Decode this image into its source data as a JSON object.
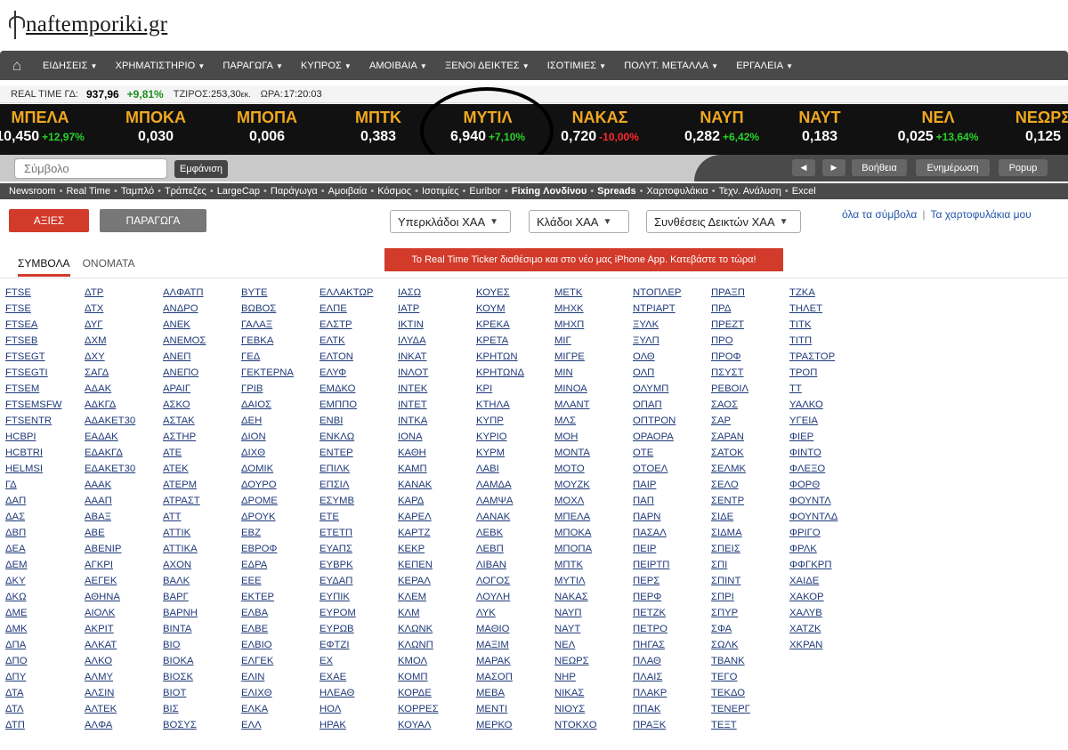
{
  "brand": {
    "name": "naftemporiki",
    "tld": ".gr"
  },
  "topnav": {
    "items": [
      "ΕΙΔΗΣΕΙΣ",
      "ΧΡΗΜΑΤΙΣΤΗΡΙΟ",
      "ΠΑΡΑΓΩΓΑ",
      "ΚΥΠΡΟΣ",
      "ΑΜΟΙΒΑΙΑ",
      "ΞΕΝΟΙ ΔΕΙΚΤΕΣ",
      "ΙΣΟΤΙΜΙΕΣ",
      "ΠΟΛΥΤ. ΜΕΤΑΛΛΑ",
      "ΕΡΓΑΛΕΙΑ"
    ]
  },
  "realtime": {
    "label_gd": "REAL TIME ΓΔ:",
    "gd_value": "937,96",
    "gd_change": "+9,81%",
    "turnover_label": "ΤΖΙΡΟΣ:",
    "turnover_value": "253,30",
    "turnover_unit": "εκ.",
    "time_label": "ΩΡΑ:",
    "time_value": "17:20:03"
  },
  "ticker": [
    {
      "sym": "ΜΠΕΛΑ",
      "price": "10,450",
      "chg": "+12,97%",
      "dir": "up"
    },
    {
      "sym": "ΜΠΟΚΑ",
      "price": "0,030",
      "chg": "",
      "dir": ""
    },
    {
      "sym": "ΜΠΟΠΑ",
      "price": "0,006",
      "chg": "",
      "dir": ""
    },
    {
      "sym": "ΜΠΤΚ",
      "price": "0,383",
      "chg": "",
      "dir": ""
    },
    {
      "sym": "ΜΥΤΙΛ",
      "price": "6,940",
      "chg": "+7,10%",
      "dir": "up"
    },
    {
      "sym": "ΝΑΚΑΣ",
      "price": "0,720",
      "chg": "-10,00%",
      "dir": "dn"
    },
    {
      "sym": "ΝΑΥΠ",
      "price": "0,282",
      "chg": "+6,42%",
      "dir": "up"
    },
    {
      "sym": "ΝΑΥΤ",
      "price": "0,183",
      "chg": "",
      "dir": ""
    },
    {
      "sym": "ΝΕΛ",
      "price": "0,025",
      "chg": "+13,64%",
      "dir": "up"
    },
    {
      "sym": "ΝΕΩΡΣ",
      "price": "0,125",
      "chg": "",
      "dir": ""
    }
  ],
  "search": {
    "placeholder": "Σύμβολο",
    "button": "Εμφάνιση",
    "prev": "◀",
    "next": "▶",
    "help": "Βοήθεια",
    "update": "Ενημέρωση",
    "popup": "Popup"
  },
  "linkbar": {
    "links": [
      "Newsroom",
      "Real Time",
      "Ταμπλό",
      "Τράπεζες",
      "LargeCap",
      "Παράγωγα",
      "Αμοιβαία",
      "Κόσμος",
      "Ισοτιμίες",
      "Euribor",
      "Fixing Λονδίνου",
      "Spreads",
      "Χαρτοφυλάκια",
      "Τεχν. Ανάλυση",
      "Excel"
    ]
  },
  "tabs": {
    "stocks": "ΑΞΙΕΣ",
    "derivatives": "ΠΑΡΑΓΩΓΑ"
  },
  "dropdowns": {
    "supersectors": "Υπερκλάδοι ΧΑΑ",
    "sectors": "Κλάδοι ΧΑΑ",
    "composites": "Συνθέσεις Δεικτών ΧΑΑ"
  },
  "toplinks": {
    "all_symbols": "όλα τα σύμβολα",
    "separator": "|",
    "portfolios": "Τα χαρτοφυλάκια μου"
  },
  "subtabs": {
    "symbols": "ΣΥΜΒΟΛΑ",
    "names": "ΟΝΟΜΑΤΑ"
  },
  "promo": "Το Real Time Ticker διαθέσιμο και στο νέο μας iPhone App. Κατεβάστε το τώρα!",
  "symbols": [
    [
      "FTSE",
      "FTSE",
      "FTSEA",
      "FTSEB",
      "FTSEGT",
      "FTSEGTI",
      "FTSEM",
      "FTSEMSFW",
      "FTSENTR",
      "HCBPI",
      "HCBTRI",
      "HELMSI",
      "ΓΔ",
      "ΔΑΠ",
      "ΔΑΣ",
      "ΔΒΠ",
      "ΔΕΑ",
      "ΔΕΜ",
      "ΔΚΥ",
      "ΔΚΩ",
      "ΔΜΕ",
      "ΔΜΚ",
      "ΔΠΑ",
      "ΔΠΟ",
      "ΔΠΥ",
      "ΔΤΑ",
      "ΔΤΛ",
      "ΔΤΠ"
    ],
    [
      "ΔΤΡ",
      "ΔΤΧ",
      "ΔΥΓ",
      "ΔΧΜ",
      "ΔΧΥ",
      "ΣΑΓΔ",
      "ΑΔΑΚ",
      "ΑΔΚΓΔ",
      "ΑΔΑΚΕΤ30",
      "ΕΑΔΑΚ",
      "ΕΔΑΚΓΔ",
      "ΕΔΑΚΕΤ30",
      "ΑΑΑΚ",
      "ΑΑΑΠ",
      "ΑΒΑΞ",
      "ΑΒΕ",
      "ABENIP",
      "ΑΓΚΡΙ",
      "ΑΕΓΕΚ",
      "ΑΘΗΝΑ",
      "ΑΙΟΛΚ",
      "ΑΚΡΙΤ",
      "ΑΛΚΑΤ",
      "ΑΛΚΟ",
      "ΑΛΜΥ",
      "ΑΛΣΙΝ",
      "ΑΛΤΕΚ",
      "ΑΛΦΑ"
    ],
    [
      "ΑΛΦΑΤΠ",
      "ΑΝΔΡΟ",
      "ΑΝΕΚ",
      "ΑΝΕΜΟΣ",
      "ΑΝΕΠ",
      "ΑΝΕΠΟ",
      "ΑΡΑΙΓ",
      "ΑΣΚΟ",
      "ΑΣΤΑΚ",
      "ΑΣΤΗΡ",
      "ΑΤΕ",
      "ΑΤΕΚ",
      "ΑΤΕΡΜ",
      "ΑΤΡΑΣΤ",
      "ΑΤΤ",
      "ΑΤΤΙΚ",
      "ΑΤΤΙΚΑ",
      "ΑΧΟΝ",
      "ΒΑΛΚ",
      "ΒΑΡΓ",
      "ΒΑΡΝΗ",
      "ΒΙΝΤΑ",
      "ΒΙΟ",
      "ΒΙΟΚΑ",
      "ΒΙΟΣΚ",
      "ΒΙΟΤ",
      "ΒΙΣ",
      "ΒΟΣΥΣ"
    ],
    [
      "ΒΥΤΕ",
      "ΒΩΒΟΣ",
      "ΓΑΛΑΞ",
      "ΓΕΒΚΑ",
      "ΓΕΔ",
      "ΓΕΚΤΕΡΝΑ",
      "ΓΡΙΒ",
      "ΔΑΙΟΣ",
      "ΔΕΗ",
      "ΔΙΟΝ",
      "ΔΙΧΘ",
      "ΔΟΜΙΚ",
      "ΔΟΥΡΟ",
      "ΔΡΟΜΕ",
      "ΔΡΟΥΚ",
      "ΕΒΖ",
      "ΕΒΡΟΦ",
      "ΕΔΡΑ",
      "ΕΕΕ",
      "ΕΚΤΕΡ",
      "ΕΛΒΑ",
      "ΕΛΒΕ",
      "ΕΛΒΙΟ",
      "ΕΛΓΕΚ",
      "ΕΛΙΝ",
      "ΕΛΙΧΘ",
      "ΕΛΚΑ",
      "ΕΛΛ"
    ],
    [
      "ΕΛΛΑΚΤΩΡ",
      "ΕΛΠΕ",
      "ΕΛΣΤΡ",
      "ΕΛΤΚ",
      "ΕΛΤΟΝ",
      "ΕΛΥΦ",
      "ΕΜΔΚΟ",
      "ΕΜΠΠΟ",
      "ΕΝΒΙ",
      "ΕΝΚΛΩ",
      "ΕΝΤΕΡ",
      "ΕΠΙΛΚ",
      "ΕΠΣΙΛ",
      "ΕΣΥΜΒ",
      "ΕΤΕ",
      "ΕΤΕΤΠ",
      "ΕΥΑΠΣ",
      "ΕΥΒΡΚ",
      "ΕΥΔΑΠ",
      "ΕΥΠΙΚ",
      "ΕΥΡΟΜ",
      "ΕΥΡΩΒ",
      "ΕΦΤΖΙ",
      "ΕΧ",
      "ΕΧΑΕ",
      "ΗΛΕΑΘ",
      "ΗΟΛ",
      "ΗΡΑΚ"
    ],
    [
      "ΙΑΣΩ",
      "ΙΑΤΡ",
      "ΙΚΤΙΝ",
      "ΙΛΥΔΑ",
      "ΙΝΚΑΤ",
      "ΙΝΛΟΤ",
      "ΙΝΤΕΚ",
      "ΙΝΤΕΤ",
      "ΙΝΤΚΑ",
      "ΙΟΝΑ",
      "ΚΑΘΗ",
      "ΚΑΜΠ",
      "ΚΑΝΑΚ",
      "ΚΑΡΔ",
      "ΚΑΡΕΛ",
      "ΚΑΡΤΖ",
      "ΚΕΚΡ",
      "ΚΕΠΕΝ",
      "ΚΕΡΑΛ",
      "ΚΛΕΜ",
      "ΚΛΜ",
      "ΚΛΩΝΚ",
      "ΚΛΩΝΠ",
      "ΚΜΟΛ",
      "ΚΟΜΠ",
      "ΚΟΡΔΕ",
      "ΚΟΡΡΕΣ",
      "ΚΟΥΑΛ"
    ],
    [
      "ΚΟΥΕΣ",
      "ΚΟΥΜ",
      "ΚΡΕΚΑ",
      "ΚΡΕΤΑ",
      "ΚΡΗΤΩΝ",
      "ΚΡΗΤΩΝΔ",
      "ΚΡΙ",
      "ΚΤΗΛΑ",
      "ΚΥΠΡ",
      "ΚΥΡΙΟ",
      "ΚΥΡΜ",
      "ΛΑΒΙ",
      "ΛΑΜΔΑ",
      "ΛΑΜΨΑ",
      "ΛΑΝΑΚ",
      "ΛΕΒΚ",
      "ΛΕΒΠ",
      "ΛΙΒΑΝ",
      "ΛΟΓΟΣ",
      "ΛΟΥΛΗ",
      "ΛΥΚ",
      "ΜΑΘΙΟ",
      "ΜΑΞΙΜ",
      "ΜΑΡΑΚ",
      "ΜΑΣΟΠ",
      "ΜΕΒΑ",
      "ΜΕΝΤΙ",
      "ΜΕΡΚΟ"
    ],
    [
      "ΜΕΤΚ",
      "ΜΗΧΚ",
      "ΜΗΧΠ",
      "ΜΙΓ",
      "ΜΙΓΡΕ",
      "ΜΙΝ",
      "ΜΙΝΟΑ",
      "ΜΛΑΝΤ",
      "ΜΛΣ",
      "ΜΟΗ",
      "ΜΟΝΤΑ",
      "ΜΟΤΟ",
      "ΜΟΥΖΚ",
      "ΜΟΧΛ",
      "ΜΠΕΛΑ",
      "ΜΠΟΚΑ",
      "ΜΠΟΠΑ",
      "ΜΠΤΚ",
      "ΜΥΤΙΛ",
      "ΝΑΚΑΣ",
      "ΝΑΥΠ",
      "ΝΑΥΤ",
      "ΝΕΛ",
      "ΝΕΩΡΣ",
      "ΝΗΡ",
      "ΝΙΚΑΣ",
      "ΝΙΟΥΣ",
      "ΝΤΟΚΧΟ"
    ],
    [
      "ΝΤΟΠΛΕΡ",
      "ΝΤΡΙΑΡΤ",
      "ΞΥΛΚ",
      "ΞΥΛΠ",
      "ΟΛΘ",
      "ΟΛΠ",
      "ΟΛΥΜΠ",
      "ΟΠΑΠ",
      "ΟΠΤΡΟΝ",
      "ΟΡΑΟΡΑ",
      "ΟΤΕ",
      "ΟΤΟΕΛ",
      "ΠΑΙΡ",
      "ΠΑΠ",
      "ΠΑΡΝ",
      "ΠΑΣΑΛ",
      "ΠΕΙΡ",
      "ΠΕΙΡΤΠ",
      "ΠΕΡΣ",
      "ΠΕΡΦ",
      "ΠΕΤΖΚ",
      "ΠΕΤΡΟ",
      "ΠΗΓΑΣ",
      "ΠΛΑΘ",
      "ΠΛΑΙΣ",
      "ΠΛΑΚΡ",
      "ΠΠΑΚ",
      "ΠΡΑΞΚ"
    ],
    [
      "ΠΡΑΞΠ",
      "ΠΡΔ",
      "ΠΡΕΖΤ",
      "ΠΡΟ",
      "ΠΡΟΦ",
      "ΠΣΥΣΤ",
      "ΡΕΒΟΙΛ",
      "ΣΑΟΣ",
      "ΣΑΡ",
      "ΣΑΡΑΝ",
      "ΣΑΤΟΚ",
      "ΣΕΛΜΚ",
      "ΣΕΛΟ",
      "ΣΕΝΤΡ",
      "ΣΙΔΕ",
      "ΣΙΔΜΑ",
      "ΣΠΕΙΣ",
      "ΣΠΙ",
      "ΣΠΙΝΤ",
      "ΣΠΡΙ",
      "ΣΠΥΡ",
      "ΣΦΑ",
      "ΣΩΛΚ",
      "TBANK",
      "ΤΕΓΟ",
      "ΤΕΚΔΟ",
      "ΤΕΝΕΡΓ",
      "ΤΕΞΤ"
    ],
    [
      "ΤΖΚΑ",
      "ΤΗΛΕΤ",
      "ΤΙΤΚ",
      "ΤΙΤΠ",
      "ΤΡΑΣΤΟΡ",
      "ΤΡΟΠ",
      "ΤΤ",
      "ΥΑΛΚΟ",
      "ΥΓΕΙΑ",
      "ΦΙΕΡ",
      "ΦΙΝΤΟ",
      "ΦΛΕΞΟ",
      "ΦΟΡΘ",
      "ΦΟΥΝΤΛ",
      "ΦΟΥΝΤΛΔ",
      "ΦΡΙΓΟ",
      "ΦΡΛΚ",
      "ΦΦΓΚΡΠ",
      "ΧΑΙΔΕ",
      "ΧΑΚΟΡ",
      "ΧΑΛΥΒ",
      "ΧΑΤΖΚ",
      "ΧΚΡΑΝ"
    ]
  ]
}
